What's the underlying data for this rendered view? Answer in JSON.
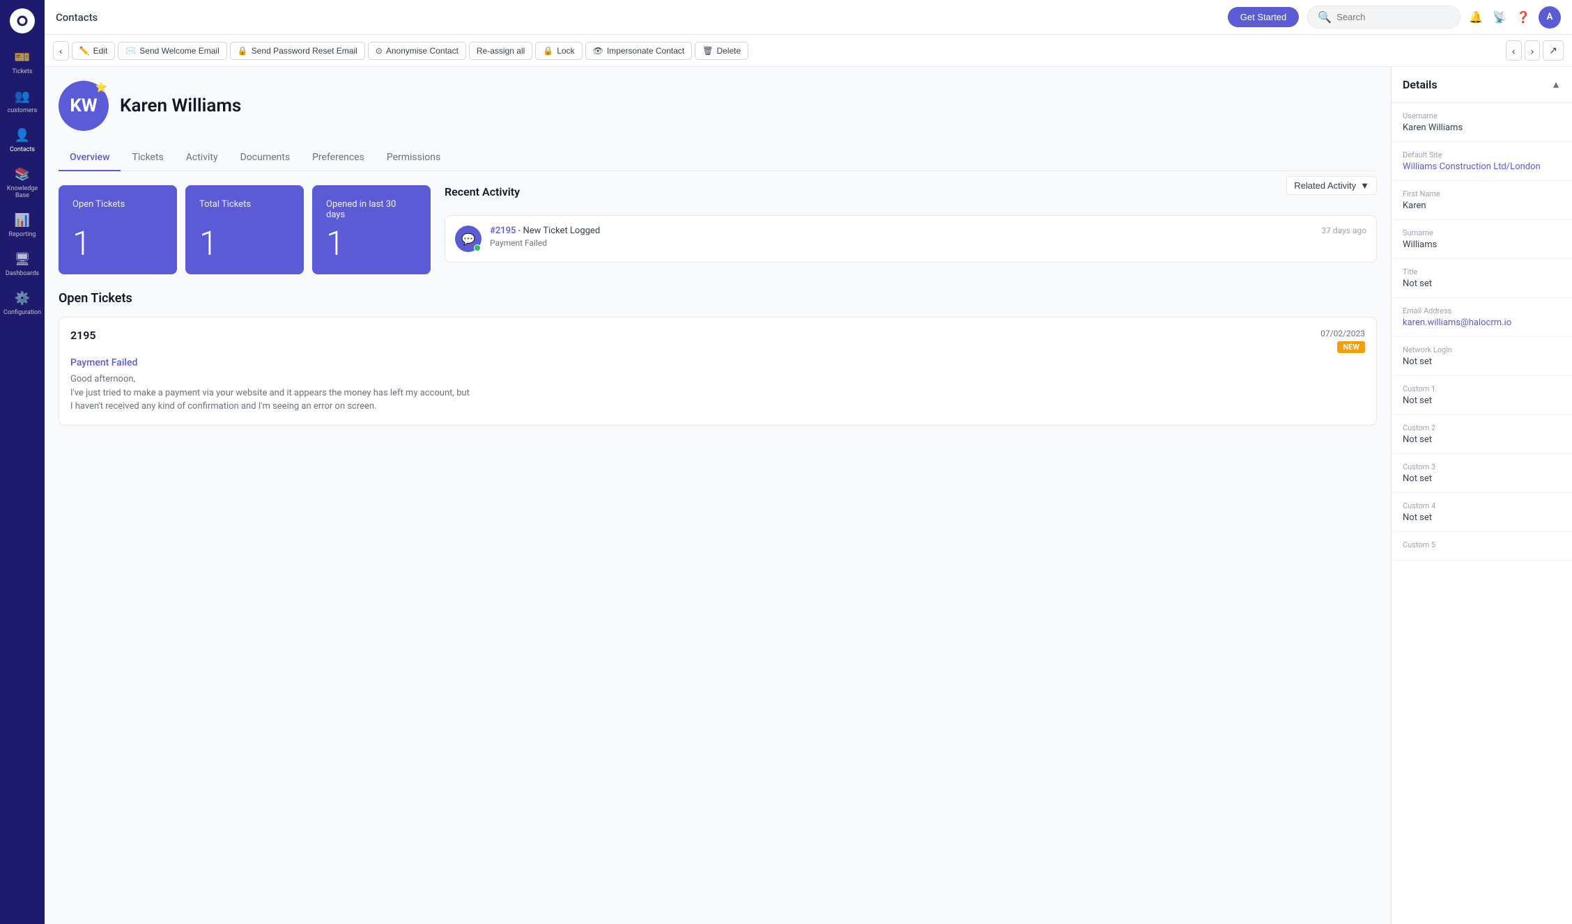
{
  "app": {
    "logo": "○"
  },
  "sidebar": {
    "items": [
      {
        "id": "tickets",
        "label": "Tickets",
        "icon": "🎫",
        "active": false
      },
      {
        "id": "customers",
        "label": "customers",
        "icon": "👥",
        "active": false
      },
      {
        "id": "contacts",
        "label": "Contacts",
        "icon": "👤",
        "active": true
      },
      {
        "id": "knowledge-base",
        "label": "Knowledge Base",
        "icon": "📚",
        "active": false
      },
      {
        "id": "reporting",
        "label": "Reporting",
        "icon": "📊",
        "active": false
      },
      {
        "id": "dashboards",
        "label": "Dashboards",
        "icon": "🖥",
        "active": false
      },
      {
        "id": "configuration",
        "label": "Configuration",
        "icon": "⚙️",
        "active": false
      }
    ]
  },
  "topbar": {
    "title": "Contacts",
    "get_started": "Get Started",
    "search_placeholder": "Search"
  },
  "action_bar": {
    "back": "‹",
    "edit": "Edit",
    "send_welcome": "Send Welcome Email",
    "send_reset": "Send Password Reset Email",
    "anonymise": "Anonymise Contact",
    "reassign": "Re-assign all",
    "lock": "Lock",
    "impersonate": "Impersonate Contact",
    "delete": "Delete"
  },
  "contact": {
    "initials": "KW",
    "name": "Karen Williams",
    "star": "⭐"
  },
  "tabs": [
    {
      "id": "overview",
      "label": "Overview",
      "active": true
    },
    {
      "id": "tickets",
      "label": "Tickets",
      "active": false
    },
    {
      "id": "activity",
      "label": "Activity",
      "active": false
    },
    {
      "id": "documents",
      "label": "Documents",
      "active": false
    },
    {
      "id": "preferences",
      "label": "Preferences",
      "active": false
    },
    {
      "id": "permissions",
      "label": "Permissions",
      "active": false
    }
  ],
  "stats": [
    {
      "label": "Open Tickets",
      "value": "1"
    },
    {
      "label": "Total Tickets",
      "value": "1"
    },
    {
      "label": "Opened in last 30 days",
      "value": "1"
    }
  ],
  "recent_activity": {
    "title": "Recent Activity",
    "filter": "Related Activity",
    "items": [
      {
        "ticket_id": "#2195",
        "event": "- New Ticket Logged",
        "subject": "Payment Failed",
        "time": "37 days ago"
      }
    ]
  },
  "open_tickets": {
    "title": "Open Tickets",
    "items": [
      {
        "id": "2195",
        "date": "07/02/2023",
        "badge": "NEW",
        "subject": "Payment Failed",
        "preview_line1": "Good afternoon,",
        "preview_line2": "I've just tried to make a payment via your website and it appears the money has left my account, but",
        "preview_line3": "I haven't received any kind of confirmation and I'm seeing an error on screen."
      }
    ]
  },
  "details": {
    "title": "Details",
    "fields": [
      {
        "label": "Username",
        "value": "Karen Williams",
        "type": "text"
      },
      {
        "label": "Default Site",
        "value": "Williams Construction Ltd/London",
        "type": "link"
      },
      {
        "label": "First Name",
        "value": "Karen",
        "type": "text"
      },
      {
        "label": "Surname",
        "value": "Williams",
        "type": "text"
      },
      {
        "label": "Title",
        "value": "Not set",
        "type": "text"
      },
      {
        "label": "Email Address",
        "value": "karen.williams@halocrm.io",
        "type": "link"
      },
      {
        "label": "Network Login",
        "value": "Not set",
        "type": "text"
      },
      {
        "label": "Custom 1",
        "value": "Not set",
        "type": "text"
      },
      {
        "label": "Custom 2",
        "value": "Not set",
        "type": "text"
      },
      {
        "label": "Custom 3",
        "value": "Not set",
        "type": "text"
      },
      {
        "label": "Custom 4",
        "value": "Not set",
        "type": "text"
      },
      {
        "label": "Custom 5",
        "value": "",
        "type": "text"
      }
    ]
  }
}
